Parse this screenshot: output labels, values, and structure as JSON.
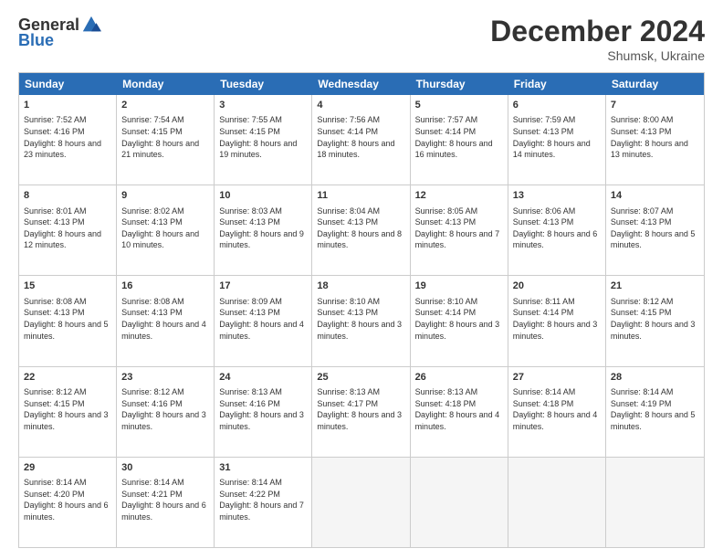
{
  "header": {
    "logo_general": "General",
    "logo_blue": "Blue",
    "month_title": "December 2024",
    "location": "Shumsk, Ukraine"
  },
  "days_of_week": [
    "Sunday",
    "Monday",
    "Tuesday",
    "Wednesday",
    "Thursday",
    "Friday",
    "Saturday"
  ],
  "weeks": [
    [
      {
        "day": "1",
        "sunrise": "7:52 AM",
        "sunset": "4:16 PM",
        "daylight": "8 hours and 23 minutes."
      },
      {
        "day": "2",
        "sunrise": "7:54 AM",
        "sunset": "4:15 PM",
        "daylight": "8 hours and 21 minutes."
      },
      {
        "day": "3",
        "sunrise": "7:55 AM",
        "sunset": "4:15 PM",
        "daylight": "8 hours and 19 minutes."
      },
      {
        "day": "4",
        "sunrise": "7:56 AM",
        "sunset": "4:14 PM",
        "daylight": "8 hours and 18 minutes."
      },
      {
        "day": "5",
        "sunrise": "7:57 AM",
        "sunset": "4:14 PM",
        "daylight": "8 hours and 16 minutes."
      },
      {
        "day": "6",
        "sunrise": "7:59 AM",
        "sunset": "4:13 PM",
        "daylight": "8 hours and 14 minutes."
      },
      {
        "day": "7",
        "sunrise": "8:00 AM",
        "sunset": "4:13 PM",
        "daylight": "8 hours and 13 minutes."
      }
    ],
    [
      {
        "day": "8",
        "sunrise": "8:01 AM",
        "sunset": "4:13 PM",
        "daylight": "8 hours and 12 minutes."
      },
      {
        "day": "9",
        "sunrise": "8:02 AM",
        "sunset": "4:13 PM",
        "daylight": "8 hours and 10 minutes."
      },
      {
        "day": "10",
        "sunrise": "8:03 AM",
        "sunset": "4:13 PM",
        "daylight": "8 hours and 9 minutes."
      },
      {
        "day": "11",
        "sunrise": "8:04 AM",
        "sunset": "4:13 PM",
        "daylight": "8 hours and 8 minutes."
      },
      {
        "day": "12",
        "sunrise": "8:05 AM",
        "sunset": "4:13 PM",
        "daylight": "8 hours and 7 minutes."
      },
      {
        "day": "13",
        "sunrise": "8:06 AM",
        "sunset": "4:13 PM",
        "daylight": "8 hours and 6 minutes."
      },
      {
        "day": "14",
        "sunrise": "8:07 AM",
        "sunset": "4:13 PM",
        "daylight": "8 hours and 5 minutes."
      }
    ],
    [
      {
        "day": "15",
        "sunrise": "8:08 AM",
        "sunset": "4:13 PM",
        "daylight": "8 hours and 5 minutes."
      },
      {
        "day": "16",
        "sunrise": "8:08 AM",
        "sunset": "4:13 PM",
        "daylight": "8 hours and 4 minutes."
      },
      {
        "day": "17",
        "sunrise": "8:09 AM",
        "sunset": "4:13 PM",
        "daylight": "8 hours and 4 minutes."
      },
      {
        "day": "18",
        "sunrise": "8:10 AM",
        "sunset": "4:13 PM",
        "daylight": "8 hours and 3 minutes."
      },
      {
        "day": "19",
        "sunrise": "8:10 AM",
        "sunset": "4:14 PM",
        "daylight": "8 hours and 3 minutes."
      },
      {
        "day": "20",
        "sunrise": "8:11 AM",
        "sunset": "4:14 PM",
        "daylight": "8 hours and 3 minutes."
      },
      {
        "day": "21",
        "sunrise": "8:12 AM",
        "sunset": "4:15 PM",
        "daylight": "8 hours and 3 minutes."
      }
    ],
    [
      {
        "day": "22",
        "sunrise": "8:12 AM",
        "sunset": "4:15 PM",
        "daylight": "8 hours and 3 minutes."
      },
      {
        "day": "23",
        "sunrise": "8:12 AM",
        "sunset": "4:16 PM",
        "daylight": "8 hours and 3 minutes."
      },
      {
        "day": "24",
        "sunrise": "8:13 AM",
        "sunset": "4:16 PM",
        "daylight": "8 hours and 3 minutes."
      },
      {
        "day": "25",
        "sunrise": "8:13 AM",
        "sunset": "4:17 PM",
        "daylight": "8 hours and 3 minutes."
      },
      {
        "day": "26",
        "sunrise": "8:13 AM",
        "sunset": "4:18 PM",
        "daylight": "8 hours and 4 minutes."
      },
      {
        "day": "27",
        "sunrise": "8:14 AM",
        "sunset": "4:18 PM",
        "daylight": "8 hours and 4 minutes."
      },
      {
        "day": "28",
        "sunrise": "8:14 AM",
        "sunset": "4:19 PM",
        "daylight": "8 hours and 5 minutes."
      }
    ],
    [
      {
        "day": "29",
        "sunrise": "8:14 AM",
        "sunset": "4:20 PM",
        "daylight": "8 hours and 6 minutes."
      },
      {
        "day": "30",
        "sunrise": "8:14 AM",
        "sunset": "4:21 PM",
        "daylight": "8 hours and 6 minutes."
      },
      {
        "day": "31",
        "sunrise": "8:14 AM",
        "sunset": "4:22 PM",
        "daylight": "8 hours and 7 minutes."
      },
      null,
      null,
      null,
      null
    ]
  ]
}
